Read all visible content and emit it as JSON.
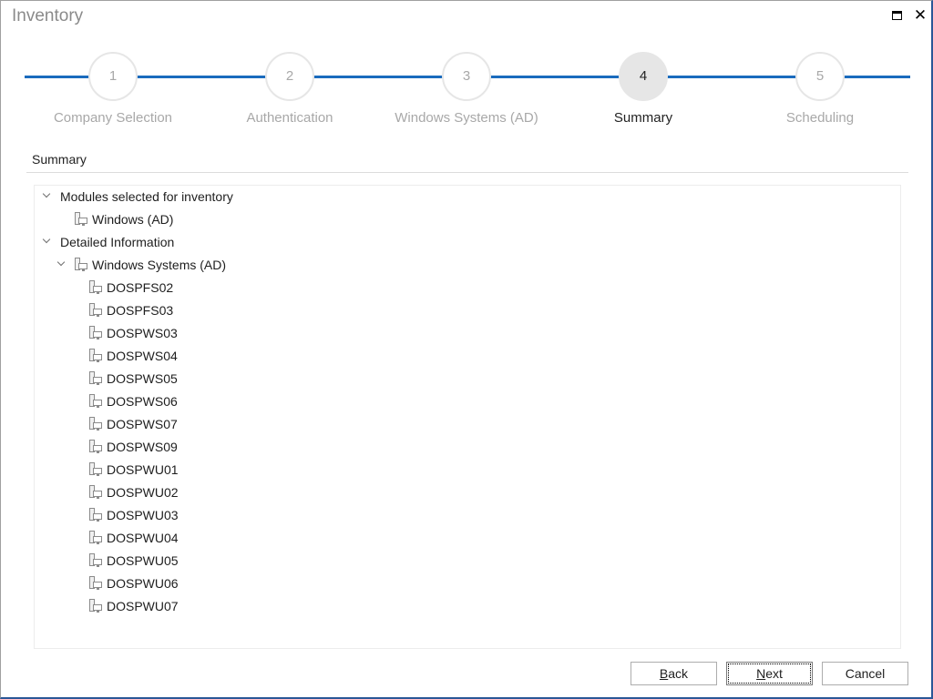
{
  "window": {
    "title": "Inventory",
    "maximize_icon": "maximize-icon",
    "close_icon": "close-icon",
    "close_glyph": "✕"
  },
  "stepper": {
    "accent_color": "#1a6bbd",
    "current_step": 4,
    "steps": [
      {
        "number": "1",
        "label": "Company Selection",
        "state": "inactive"
      },
      {
        "number": "2",
        "label": "Authentication",
        "state": "inactive"
      },
      {
        "number": "3",
        "label": "Windows Systems (AD)",
        "state": "inactive"
      },
      {
        "number": "4",
        "label": "Summary",
        "state": "active"
      },
      {
        "number": "5",
        "label": "Scheduling",
        "state": "inactive"
      }
    ]
  },
  "section": {
    "title": "Summary"
  },
  "tree": {
    "modules_group": {
      "label": "Modules selected for inventory",
      "expanded": true,
      "children": [
        {
          "label": "Windows (AD)",
          "icon": "computer-icon"
        }
      ]
    },
    "details_group": {
      "label": "Detailed Information",
      "expanded": true,
      "subgroup": {
        "label": "Windows Systems (AD)",
        "icon": "computer-icon",
        "expanded": true,
        "children": [
          "DOSPFS02",
          "DOSPFS03",
          "DOSPWS03",
          "DOSPWS04",
          "DOSPWS05",
          "DOSPWS06",
          "DOSPWS07",
          "DOSPWS09",
          "DOSPWU01",
          "DOSPWU02",
          "DOSPWU03",
          "DOSPWU04",
          "DOSPWU05",
          "DOSPWU06",
          "DOSPWU07"
        ]
      }
    }
  },
  "buttons": {
    "back": {
      "label_mnemonic": "B",
      "label_rest": "ack"
    },
    "next": {
      "label_mnemonic": "N",
      "label_rest": "ext",
      "focused": true
    },
    "cancel": {
      "label": "Cancel"
    }
  }
}
